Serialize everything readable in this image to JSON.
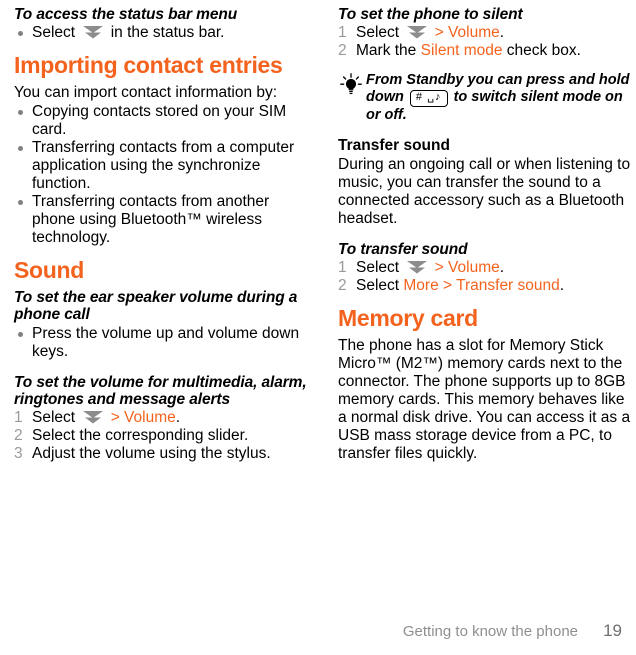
{
  "document": {
    "footer": {
      "section_title": "Getting to know the phone",
      "page_number": "19"
    },
    "accent_color": "#F4631E",
    "number_color": "#9a9a9a"
  },
  "left_column": {
    "task1": {
      "heading": "To access the status bar menu",
      "bullets": [
        {
          "before": "Select ",
          "icon": "chevron-down-icon",
          "after": " in the status bar."
        }
      ]
    },
    "section_importing": {
      "title": "Importing contact entries",
      "intro": "You can import contact information by:",
      "bullets": [
        "Copying contacts stored on your SIM card.",
        "Transferring contacts from a computer application using the synchronize function.",
        "Transferring contacts from another phone using Bluetooth™ wireless technology."
      ]
    },
    "section_sound": {
      "title": "Sound",
      "task_ear_speaker": {
        "heading": "To set the ear speaker volume during a phone call",
        "bullets": [
          "Press the volume up and volume down keys."
        ]
      },
      "task_volume": {
        "heading": "To set the volume for multimedia, alarm, ringtones and message alerts",
        "steps": [
          {
            "num": "1",
            "prefix": "Select ",
            "icon": "chevron-down-icon",
            "link": " > Volume",
            "suffix": "."
          },
          {
            "num": "2",
            "prefix": "Select the corresponding slider.",
            "icon": "",
            "link": "",
            "suffix": ""
          },
          {
            "num": "3",
            "prefix": "Adjust the volume using the stylus.",
            "icon": "",
            "link": "",
            "suffix": ""
          }
        ]
      }
    }
  },
  "right_column": {
    "task_silent": {
      "heading": "To set the phone to silent",
      "steps": [
        {
          "num": "1",
          "prefix": "Select ",
          "icon": "chevron-down-icon",
          "link": " > Volume",
          "suffix": "."
        },
        {
          "num": "2",
          "prefix": "Mark the ",
          "icon": "",
          "link": "Silent mode",
          "suffix": " check box."
        }
      ]
    },
    "tip": {
      "icon": "lightbulb-icon",
      "text_before": "From Standby you can press and hold down ",
      "keycap": "# ␣♪",
      "text_after": " to switch silent mode on or off."
    },
    "subsection_transfer": {
      "heading": "Transfer sound",
      "body": "During an ongoing call or when listening to music, you can transfer the sound to a connected accessory such as a Bluetooth headset.",
      "task": {
        "heading": "To transfer sound",
        "steps": [
          {
            "num": "1",
            "prefix": "Select ",
            "icon": "chevron-down-icon",
            "link": " > Volume",
            "suffix": "."
          },
          {
            "num": "2",
            "prefix": "Select ",
            "icon": "",
            "link": "More > Transfer sound",
            "suffix": "."
          }
        ]
      }
    },
    "section_memory": {
      "title": "Memory card",
      "body": "The phone has a slot for Memory Stick Micro™ (M2™) memory cards next to the connector. The phone supports up to 8GB memory cards. This memory behaves like a normal disk drive. You can access it as a USB mass storage device from a PC, to transfer files quickly."
    }
  }
}
